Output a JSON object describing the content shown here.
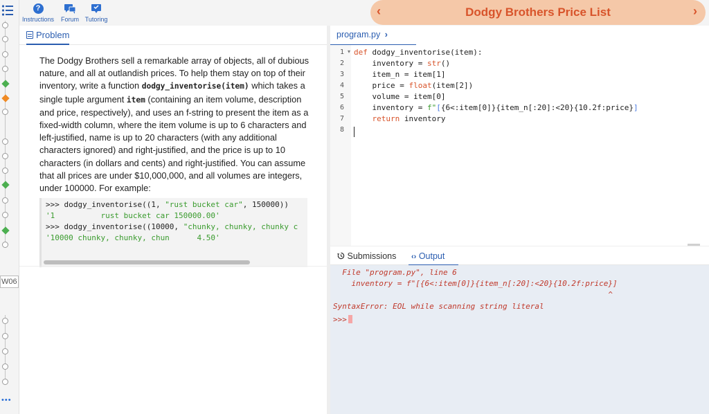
{
  "nav": {
    "instructions_label": "Instructions",
    "forum_label": "Forum",
    "tutoring_label": "Tutoring"
  },
  "title_bar": {
    "title": "Dodgy Brothers Price List",
    "prev_glyph": "‹",
    "next_glyph": "›"
  },
  "rail": {
    "week_label": "W06",
    "more_glyph": "•••"
  },
  "problem": {
    "tab_label": "Problem",
    "paragraph": [
      "The Dodgy Brothers sell a remarkable array of objects, all of dubious nature, and all at outlandish prices. To help them stay on top of their inventory, write a function ",
      "dodgy_inventorise(item)",
      " which takes a single tuple argument ",
      "item",
      " (containing an item volume, description and price, respectively), and uses an f-string to present the item as a fixed-width column, where the item volume is up to 6 characters and left-justified, name is up to 20 characters (with any additional characters ignored) and right-justified, and the price is up to 10 characters (in dollars and cents) and right-justified. You can assume that all prices are under $10,000,000, and all volumes are integers, under 100000. For example:"
    ],
    "example": {
      "line1_call": ">>> dodgy_inventorise((1, ",
      "line1_str": "\"rust bucket car\"",
      "line1_end": ", 150000))",
      "line2": "'1          rust bucket car 150000.00'",
      "line3_call": ">>> dodgy_inventorise((10000, ",
      "line3_str": "\"chunky, chunky, chunky c",
      "line4": "'10000 chunky, chunky, chun      4.50'"
    }
  },
  "editor": {
    "file_tab": "program.py",
    "line_numbers": [
      "1",
      "2",
      "3",
      "4",
      "5",
      "6",
      "7",
      "8"
    ],
    "code": {
      "l1_kw": "def",
      "l1_rest": " dodgy_inventorise(item):",
      "l2_pre": "    inventory = ",
      "l2_fn": "str",
      "l2_post": "()",
      "l3": "    item_n = item[1]",
      "l4_pre": "    price = ",
      "l4_fn": "float",
      "l4_post": "(item[2])",
      "l5": "    volume = item[0]",
      "l6_pre": "    inventory = ",
      "l6_str1": "f\"",
      "l6_br1": "[",
      "l6_str2": "{6<:item[0]}{item_n[:20]:<20}{10.2f:price}",
      "l6_br2": "]",
      "l7_kw": "    return",
      "l7_rest": " inventory"
    }
  },
  "output": {
    "tab_submissions": "Submissions",
    "tab_output": "Output",
    "console_lines": [
      "  File \"program.py\", line 6",
      "    inventory = f\"[{6<:item[0]}{item_n[:20]:<20}{10.2f:price}]",
      "                                                            ^",
      "SyntaxError: EOL while scanning string literal"
    ],
    "prompt": ">>>"
  },
  "colors": {
    "accent_blue": "#2a5db0",
    "title_orange": "#d8542b",
    "title_bg": "#f5c8a8",
    "string_green": "#3a9b2e",
    "error_red": "#c0392b",
    "console_bg": "#e8edf4"
  }
}
